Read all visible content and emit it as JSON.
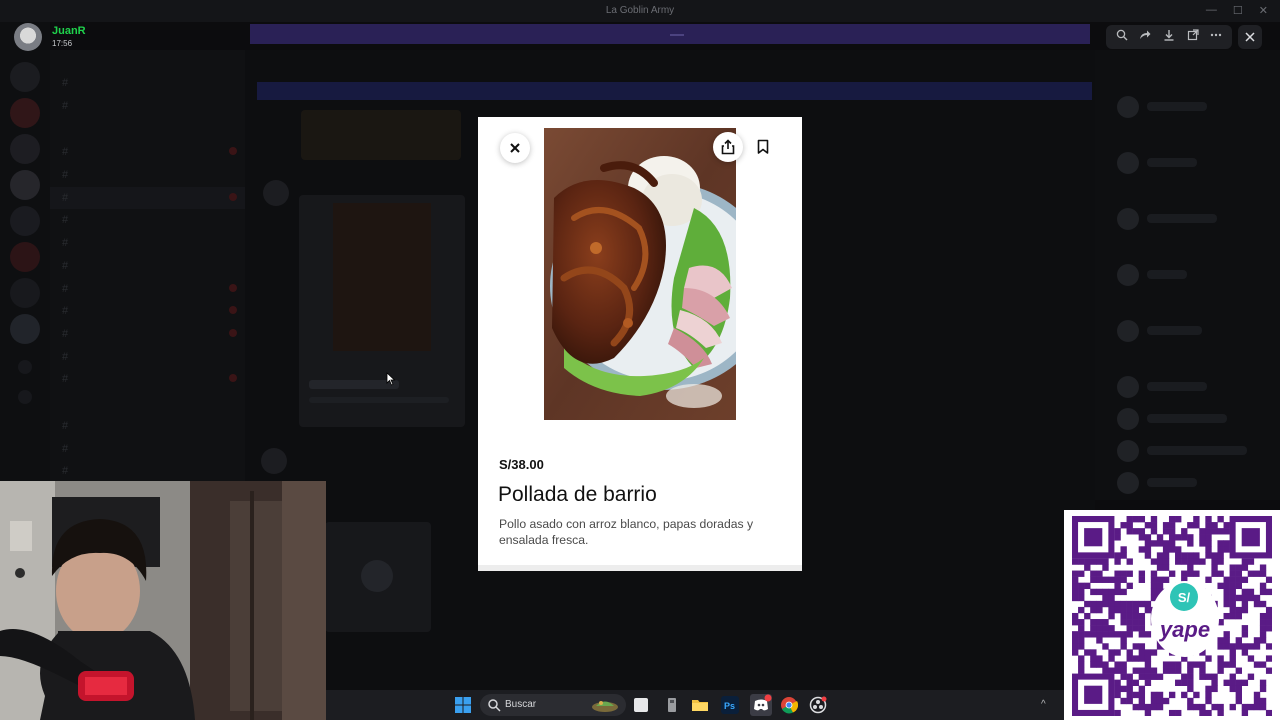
{
  "window": {
    "title": "La Goblin Army",
    "controls": [
      "—",
      "☐",
      "✕"
    ]
  },
  "user_badge": {
    "name": "JuanR",
    "time": "17:56"
  },
  "viewer_tools": {
    "icons": [
      "zoom-icon",
      "forward-icon",
      "download-icon",
      "open-external-icon",
      "more-icon"
    ],
    "close_icon": "close-icon"
  },
  "dish": {
    "price": "S/38.00",
    "title": "Pollada de barrio",
    "description": "Pollo asado con arroz blanco, papas doradas y ensalada fresca."
  },
  "taskbar": {
    "search_label": "Buscar"
  },
  "qr": {
    "badge": "S/",
    "brand": "yape",
    "color": "#5a1b86"
  },
  "colors": {
    "username": "#1fd24c",
    "modal_bg": "#ffffff",
    "qr_purple": "#5a1b86"
  }
}
